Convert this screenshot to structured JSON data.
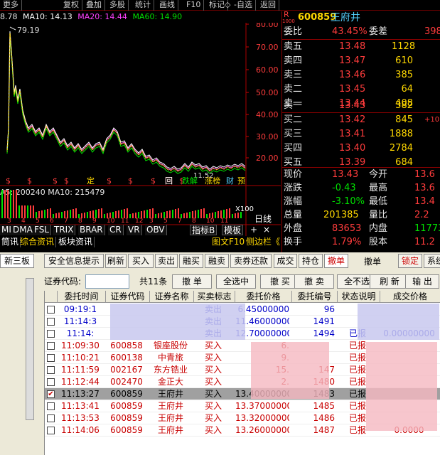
{
  "menu": [
    "更多",
    "复权",
    "叠加",
    "多股",
    "统计",
    "画线",
    "F10",
    "标记",
    "-自选",
    "返回"
  ],
  "ma": {
    "price": "8.78",
    "ma10": "MA10: 14.13",
    "ma20": "MA20: 14.44",
    "ma60": "MA60: 14.90"
  },
  "chart": {
    "y_ticks": [
      "80.00",
      "70.00",
      "60.00",
      "50.00",
      "40.00",
      "30.00",
      "20.00"
    ],
    "peak_label": "79.19",
    "low_label": "11.52",
    "markers": [
      "$",
      "$",
      "$",
      "$",
      "定",
      "$",
      "$",
      "$",
      "回",
      "$"
    ],
    "badges": [
      "回",
      "跌解",
      "涨榜",
      "财",
      "预"
    ],
    "badge_colors": [
      "#ffffff",
      "#00e000",
      "#ffd800",
      "#54d0ff",
      "#ffd800"
    ],
    "vol_line": "A5: 200240  MA10: 215479",
    "vol_unit": "X100",
    "day_label": "日线",
    "month_ticks": [
      "3",
      "4",
      "5",
      "6",
      "7",
      "8",
      "9",
      "10",
      "11",
      "12",
      "3",
      "5",
      "7",
      "8",
      "10",
      "11"
    ],
    "tech_tabs": [
      "MI",
      "DMA",
      "FSL",
      "TRIX",
      "BRAR",
      "CR",
      "VR",
      "OBV"
    ],
    "tech_extra": [
      "指标B",
      "模板"
    ],
    "info_tabs": [
      "筒讯",
      "综合资讯",
      "板块资讯"
    ],
    "info_right": [
      "图文F10",
      "侧边栏《"
    ]
  },
  "quote": {
    "marker": "R",
    "code_small": "1000",
    "code": "600859",
    "name": "王府井",
    "weibi_label": "委比",
    "weibi": "43.45%",
    "weicha_label": "委差",
    "weicha": "398",
    "sells": [
      {
        "label": "卖五",
        "price": "13.48",
        "vol": "1128"
      },
      {
        "label": "卖四",
        "price": "13.47",
        "vol": "610"
      },
      {
        "label": "卖三",
        "price": "13.46",
        "vol": "385"
      },
      {
        "label": "卖二",
        "price": "13.45",
        "vol": "64"
      },
      {
        "label": "卖一",
        "price": "13.44",
        "vol": "408"
      }
    ],
    "buys": [
      {
        "label": "买一",
        "price": "13.43",
        "vol": "382",
        "extra": ""
      },
      {
        "label": "买二",
        "price": "13.42",
        "vol": "845",
        "extra": "+10"
      },
      {
        "label": "买三",
        "price": "13.41",
        "vol": "1888",
        "extra": ""
      },
      {
        "label": "买四",
        "price": "13.40",
        "vol": "2784",
        "extra": ""
      },
      {
        "label": "买五",
        "price": "13.39",
        "vol": "684",
        "extra": ""
      }
    ],
    "stats": [
      {
        "l1": "现价",
        "v1": "13.43",
        "l2": "今开",
        "v2": "13.6"
      },
      {
        "l1": "涨跌",
        "v1": "-0.43",
        "l2": "最高",
        "v2": "13.6"
      },
      {
        "l1": "涨幅",
        "v1": "-3.10%",
        "l2": "最低",
        "v2": "13.4"
      },
      {
        "l1": "总量",
        "v1": "201385",
        "l2": "量比",
        "v2": "2.2"
      },
      {
        "l1": "外盘",
        "v1": "83653",
        "l2": "内盘",
        "v2": "11773"
      },
      {
        "l1": "换手",
        "v1": "1.79%",
        "l2": "股本",
        "v2": "11.2"
      }
    ]
  },
  "trade": {
    "side_tab": "新三板",
    "toolbar": [
      "安全信息提示",
      "刷新",
      "买入",
      "卖出",
      "融买",
      "融卖",
      "卖券还款",
      "成交",
      "持仓",
      "撤单"
    ],
    "toolbar_title": "撤单",
    "toolbar_right": [
      "锁定",
      "系统"
    ],
    "code_label": "证券代码:",
    "count": "共11条",
    "actions": [
      "撤 单",
      "全选中",
      "撤 买",
      "撤 卖",
      "全不选",
      "刷 新",
      "输 出"
    ],
    "headers": [
      "委托时间",
      "证券代码",
      "证券名称",
      "买卖标志",
      "委托价格",
      "委托编号",
      "状态说明",
      "成交价格"
    ],
    "rows": [
      {
        "time": "09:19:1",
        "code": "",
        "name": "",
        "side": "卖出",
        "price": "6.45000000",
        "no": "96",
        "status": "",
        "deal": "",
        "checked": false,
        "color": "blue"
      },
      {
        "time": "11:14:3",
        "code": "",
        "name": "",
        "side": "卖出",
        "price": "11.46000000",
        "no": "1491",
        "status": "",
        "deal": "",
        "checked": false,
        "color": "blue"
      },
      {
        "time": "11:14:",
        "code": "",
        "name": "",
        "side": "卖出",
        "price": "12.70000000",
        "no": "1494",
        "status": "已报",
        "deal": "0.00000000",
        "checked": false,
        "color": "blue"
      },
      {
        "time": "11:09:30",
        "code": "600858",
        "name": "银座股份",
        "side": "买入",
        "price": "6.",
        "no": "",
        "status": "已报",
        "deal": "",
        "checked": false,
        "color": "red"
      },
      {
        "time": "11:10:21",
        "code": "600138",
        "name": "中青旅",
        "side": "买入",
        "price": "9.",
        "no": "",
        "status": "已报",
        "deal": "",
        "checked": false,
        "color": "red"
      },
      {
        "time": "11:11:59",
        "code": "002167",
        "name": "东方锆业",
        "side": "买入",
        "price": "15.",
        "no": "147",
        "status": "已报",
        "deal": "",
        "checked": false,
        "color": "red"
      },
      {
        "time": "11:12:44",
        "code": "002470",
        "name": "金正大",
        "side": "买入",
        "price": "2.",
        "no": "1480",
        "status": "已报",
        "deal": "",
        "checked": false,
        "color": "red"
      },
      {
        "time": "11:13:27",
        "code": "600859",
        "name": "王府井",
        "side": "买入",
        "price": "13.40000000",
        "no": "1483",
        "status": "已报",
        "deal": "",
        "checked": true,
        "color": "black"
      },
      {
        "time": "11:13:41",
        "code": "600859",
        "name": "王府井",
        "side": "买入",
        "price": "13.37000000",
        "no": "1485",
        "status": "已报",
        "deal": "",
        "checked": false,
        "color": "red"
      },
      {
        "time": "11:13:53",
        "code": "600859",
        "name": "王府井",
        "side": "买入",
        "price": "13.32000000",
        "no": "1486",
        "status": "已报",
        "deal": "",
        "checked": false,
        "color": "red"
      },
      {
        "time": "11:14:06",
        "code": "600859",
        "name": "王府井",
        "side": "买入",
        "price": "13.26000000",
        "no": "1487",
        "status": "已报",
        "deal": "0.0000",
        "checked": false,
        "color": "red"
      }
    ]
  }
}
